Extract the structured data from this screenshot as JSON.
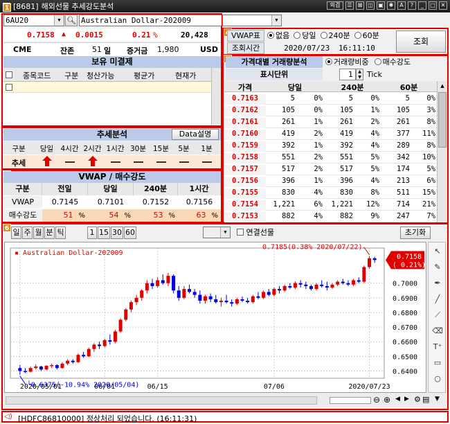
{
  "window": {
    "code": "[8681]",
    "title": "해외선물 추세강도분석",
    "icons": [
      "외겹",
      "☰",
      "⊠",
      "◫",
      "▣",
      "✱",
      "A",
      "?",
      "_",
      "□",
      "✕"
    ]
  },
  "symbol": {
    "code": "6AU20",
    "name": "Australian Dollar-202009"
  },
  "quote": {
    "price": "0.7158",
    "arrow": "▲",
    "change": "0.0015",
    "pct": "0.21",
    "pct_unit": "%",
    "volume": "20,428",
    "exchange": "CME",
    "remain_label": "잔존",
    "remain_days": "51",
    "remain_unit": "일",
    "margin_label": "증거금",
    "margin": "1,980",
    "currency": "USD"
  },
  "holdings": {
    "title": "보유 미결제",
    "columns": [
      "종목코드",
      "구분",
      "청산가능",
      "평균가",
      "현재가"
    ]
  },
  "trend": {
    "title": "추세분석",
    "data_btn": "Data설명",
    "row_header": "구분",
    "row_label": "추세",
    "columns": [
      "당일",
      "4시간",
      "2시간",
      "1시간",
      "30분",
      "15분",
      "5분",
      "1분"
    ],
    "signals": [
      "up",
      "dash",
      "up",
      "dash",
      "dash",
      "dash",
      "dash",
      "dash"
    ]
  },
  "vwap": {
    "title": "VWAP / 매수강도",
    "columns": [
      "구분",
      "전일",
      "당일",
      "240분",
      "1시간"
    ],
    "row1_label": "VWAP",
    "row1": [
      "0.7145",
      "0.7101",
      "0.7152",
      "0.7156"
    ],
    "row2_label": "매수강도",
    "row2": [
      "51",
      "54",
      "53",
      "63"
    ],
    "row2_unit": "%"
  },
  "vwap_display": {
    "label": "VWAP표시",
    "options": [
      "없음",
      "당일",
      "240분",
      "60분"
    ],
    "selected": 0,
    "time_label": "조회시간",
    "time": "2020/07/23",
    "clock": "16:11:10",
    "query_btn": "조회"
  },
  "price_analysis": {
    "title": "가격대별 거래량분석",
    "options": [
      "거래량비중",
      "매수강도"
    ],
    "selected": 0,
    "unit_label": "표시단위",
    "unit_value": "1",
    "unit_name": "Tick",
    "columns": [
      "가격",
      "당일",
      "240분",
      "60분"
    ],
    "rows": [
      [
        "0.7163",
        "5",
        "0%",
        "5",
        "0%",
        "5",
        "0%"
      ],
      [
        "0.7162",
        "105",
        "0%",
        "105",
        "1%",
        "105",
        "3%"
      ],
      [
        "0.7161",
        "261",
        "1%",
        "261",
        "2%",
        "261",
        "8%"
      ],
      [
        "0.7160",
        "419",
        "2%",
        "419",
        "4%",
        "377",
        "11%"
      ],
      [
        "0.7159",
        "392",
        "1%",
        "392",
        "4%",
        "289",
        "8%"
      ],
      [
        "0.7158",
        "551",
        "2%",
        "551",
        "5%",
        "342",
        "10%"
      ],
      [
        "0.7157",
        "517",
        "2%",
        "517",
        "5%",
        "174",
        "5%"
      ],
      [
        "0.7156",
        "396",
        "1%",
        "396",
        "4%",
        "213",
        "6%"
      ],
      [
        "0.7155",
        "830",
        "4%",
        "830",
        "8%",
        "511",
        "15%"
      ],
      [
        "0.7154",
        "1,221",
        "6%",
        "1,221",
        "12%",
        "714",
        "21%"
      ],
      [
        "0.7153",
        "882",
        "4%",
        "882",
        "9%",
        "247",
        "7%"
      ]
    ]
  },
  "chart_toolbar": {
    "periods": [
      "일",
      "주",
      "월",
      "분",
      "틱"
    ],
    "minutes": [
      "1",
      "15",
      "30",
      "60"
    ],
    "link_label": "연결선물",
    "reset_btn": "초기화"
  },
  "chart_data": {
    "type": "candlestick",
    "title": "Australian Dollar-202009",
    "current_label": "0.7158",
    "current_pct": "( 0.21%)",
    "high_annotation": "0.7185(0.38% 2020/07/22)",
    "low_annotation": "0.6375(-10.94% 2020/05/04)",
    "ylim": [
      0.635,
      0.724
    ],
    "yticks": [
      "0.7000",
      "0.6900",
      "0.6800",
      "0.6700",
      "0.6600",
      "0.6500",
      "0.6400"
    ],
    "xticks": [
      "2020/05/01",
      "06/01",
      "06/15",
      "07/06",
      "2020/07/23"
    ],
    "candles": [
      [
        0.642,
        0.644,
        0.6375,
        0.64
      ],
      [
        0.64,
        0.642,
        0.6385,
        0.6395
      ],
      [
        0.6395,
        0.643,
        0.639,
        0.642
      ],
      [
        0.642,
        0.6445,
        0.641,
        0.643
      ],
      [
        0.643,
        0.6435,
        0.64,
        0.641
      ],
      [
        0.641,
        0.644,
        0.6405,
        0.6435
      ],
      [
        0.6435,
        0.645,
        0.642,
        0.644
      ],
      [
        0.644,
        0.6445,
        0.641,
        0.642
      ],
      [
        0.642,
        0.646,
        0.6415,
        0.645
      ],
      [
        0.645,
        0.648,
        0.644,
        0.647
      ],
      [
        0.647,
        0.648,
        0.645,
        0.646
      ],
      [
        0.646,
        0.652,
        0.6455,
        0.651
      ],
      [
        0.651,
        0.653,
        0.649,
        0.65
      ],
      [
        0.65,
        0.656,
        0.6495,
        0.655
      ],
      [
        0.655,
        0.659,
        0.653,
        0.658
      ],
      [
        0.658,
        0.66,
        0.655,
        0.657
      ],
      [
        0.657,
        0.662,
        0.656,
        0.661
      ],
      [
        0.661,
        0.665,
        0.658,
        0.66
      ],
      [
        0.66,
        0.668,
        0.659,
        0.667
      ],
      [
        0.667,
        0.676,
        0.666,
        0.675
      ],
      [
        0.675,
        0.683,
        0.674,
        0.682
      ],
      [
        0.682,
        0.688,
        0.68,
        0.687
      ],
      [
        0.687,
        0.692,
        0.685,
        0.69
      ],
      [
        0.69,
        0.696,
        0.688,
        0.695
      ],
      [
        0.695,
        0.702,
        0.693,
        0.7
      ],
      [
        0.7,
        0.703,
        0.696,
        0.698
      ],
      [
        0.698,
        0.704,
        0.697,
        0.702
      ],
      [
        0.702,
        0.706,
        0.699,
        0.7
      ],
      [
        0.7,
        0.707,
        0.698,
        0.705
      ],
      [
        0.705,
        0.706,
        0.693,
        0.695
      ],
      [
        0.695,
        0.698,
        0.688,
        0.69
      ],
      [
        0.69,
        0.698,
        0.689,
        0.696
      ],
      [
        0.696,
        0.699,
        0.693,
        0.694
      ],
      [
        0.694,
        0.696,
        0.69,
        0.692
      ],
      [
        0.692,
        0.695,
        0.686,
        0.688
      ],
      [
        0.688,
        0.692,
        0.686,
        0.691
      ],
      [
        0.691,
        0.693,
        0.687,
        0.689
      ],
      [
        0.689,
        0.692,
        0.686,
        0.687
      ],
      [
        0.687,
        0.69,
        0.684,
        0.688
      ],
      [
        0.688,
        0.692,
        0.686,
        0.687
      ],
      [
        0.687,
        0.689,
        0.684,
        0.686
      ],
      [
        0.686,
        0.69,
        0.685,
        0.689
      ],
      [
        0.689,
        0.691,
        0.687,
        0.688
      ],
      [
        0.688,
        0.69,
        0.686,
        0.687
      ],
      [
        0.687,
        0.692,
        0.686,
        0.691
      ],
      [
        0.691,
        0.694,
        0.689,
        0.69
      ],
      [
        0.69,
        0.695,
        0.689,
        0.694
      ],
      [
        0.694,
        0.696,
        0.691,
        0.692
      ],
      [
        0.692,
        0.697,
        0.691,
        0.696
      ],
      [
        0.696,
        0.698,
        0.693,
        0.695
      ],
      [
        0.695,
        0.699,
        0.694,
        0.698
      ],
      [
        0.698,
        0.7,
        0.696,
        0.697
      ],
      [
        0.697,
        0.701,
        0.696,
        0.7
      ],
      [
        0.7,
        0.702,
        0.697,
        0.699
      ],
      [
        0.699,
        0.701,
        0.696,
        0.698
      ],
      [
        0.698,
        0.699,
        0.695,
        0.696
      ],
      [
        0.696,
        0.7,
        0.695,
        0.699
      ],
      [
        0.699,
        0.702,
        0.697,
        0.698
      ],
      [
        0.698,
        0.701,
        0.695,
        0.697
      ],
      [
        0.697,
        0.7,
        0.696,
        0.699
      ],
      [
        0.699,
        0.702,
        0.698,
        0.701
      ],
      [
        0.701,
        0.703,
        0.699,
        0.7
      ],
      [
        0.7,
        0.702,
        0.698,
        0.699
      ],
      [
        0.699,
        0.703,
        0.698,
        0.702
      ],
      [
        0.702,
        0.704,
        0.7,
        0.701
      ],
      [
        0.701,
        0.712,
        0.7,
        0.711
      ],
      [
        0.711,
        0.7185,
        0.71,
        0.717
      ],
      [
        0.717,
        0.718,
        0.714,
        0.7158
      ]
    ]
  },
  "status": {
    "message": "[HDFC86810000] 정상처리 되었습니다. (16:11:31)"
  }
}
